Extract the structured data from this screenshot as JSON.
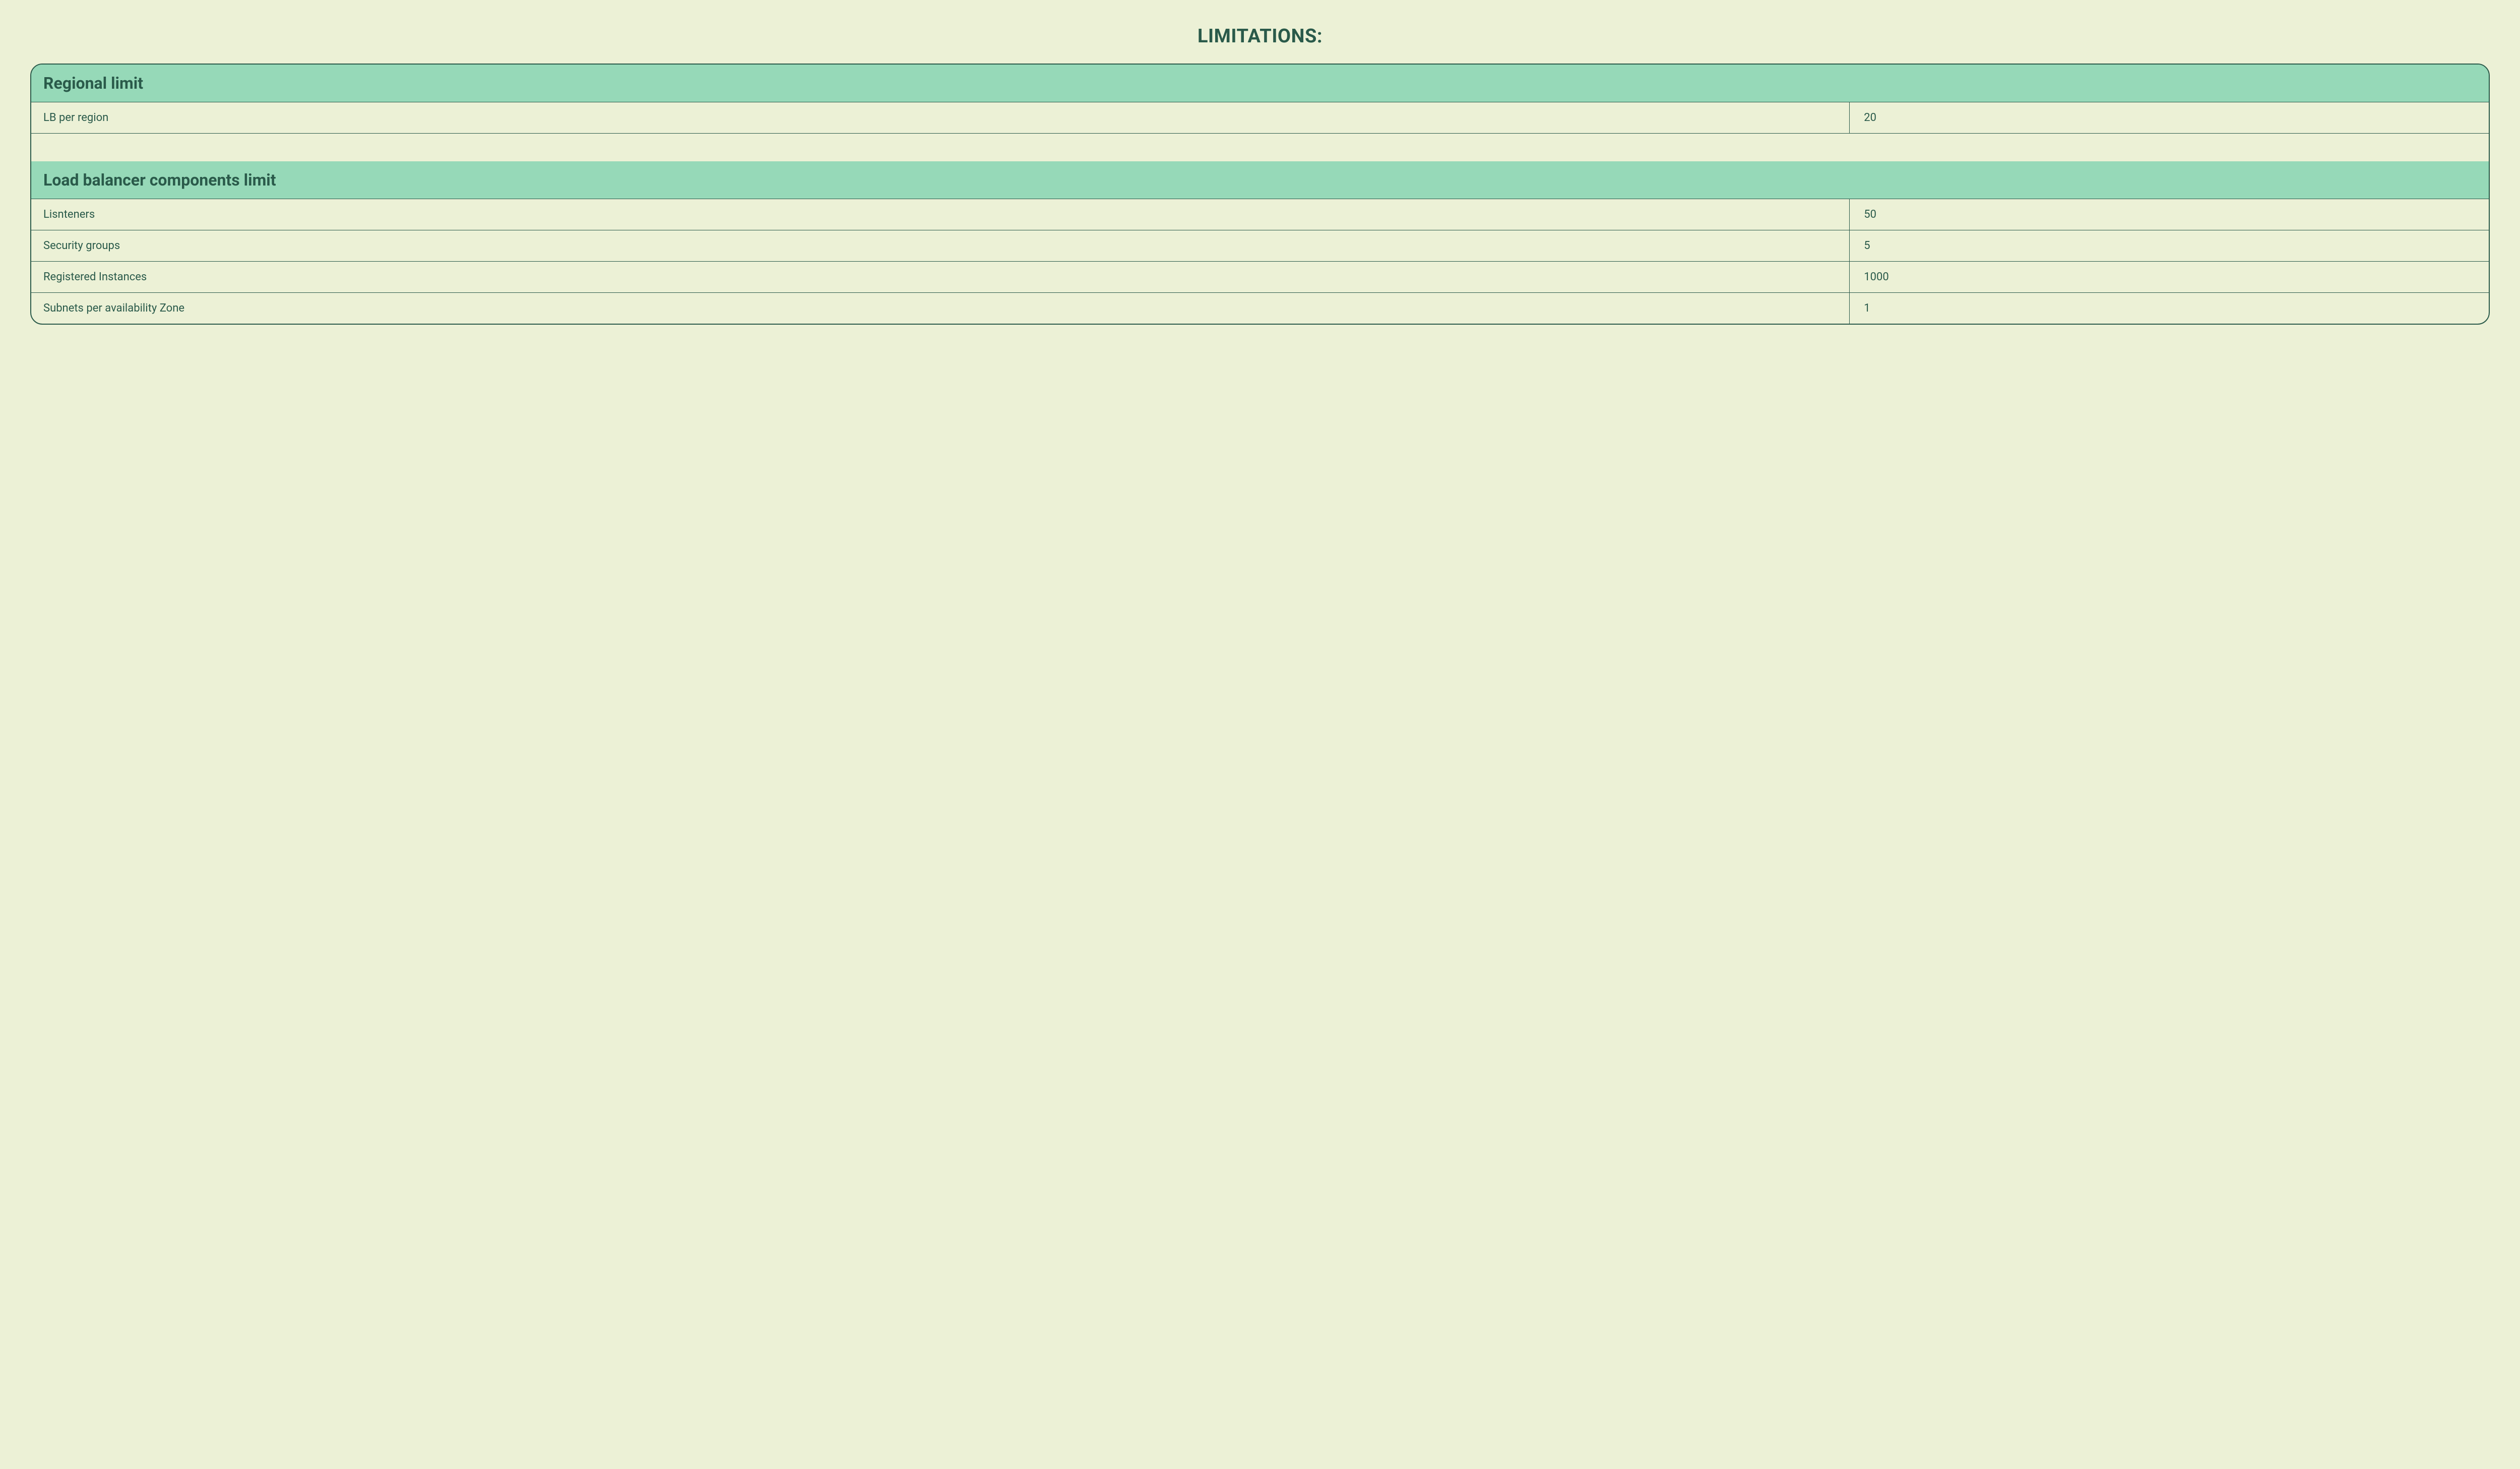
{
  "title": "LIMITATIONS:",
  "sections": [
    {
      "header": "Regional limit",
      "rows": [
        {
          "label": "LB per region",
          "value": "20"
        }
      ]
    },
    {
      "header": "Load balancer components limit",
      "rows": [
        {
          "label": "Lisnteners",
          "value": "50"
        },
        {
          "label": "Security groups",
          "value": "5"
        },
        {
          "label": "Registered Instances",
          "value": "1000"
        },
        {
          "label": "Subnets per availability Zone",
          "value": "1"
        }
      ]
    }
  ]
}
